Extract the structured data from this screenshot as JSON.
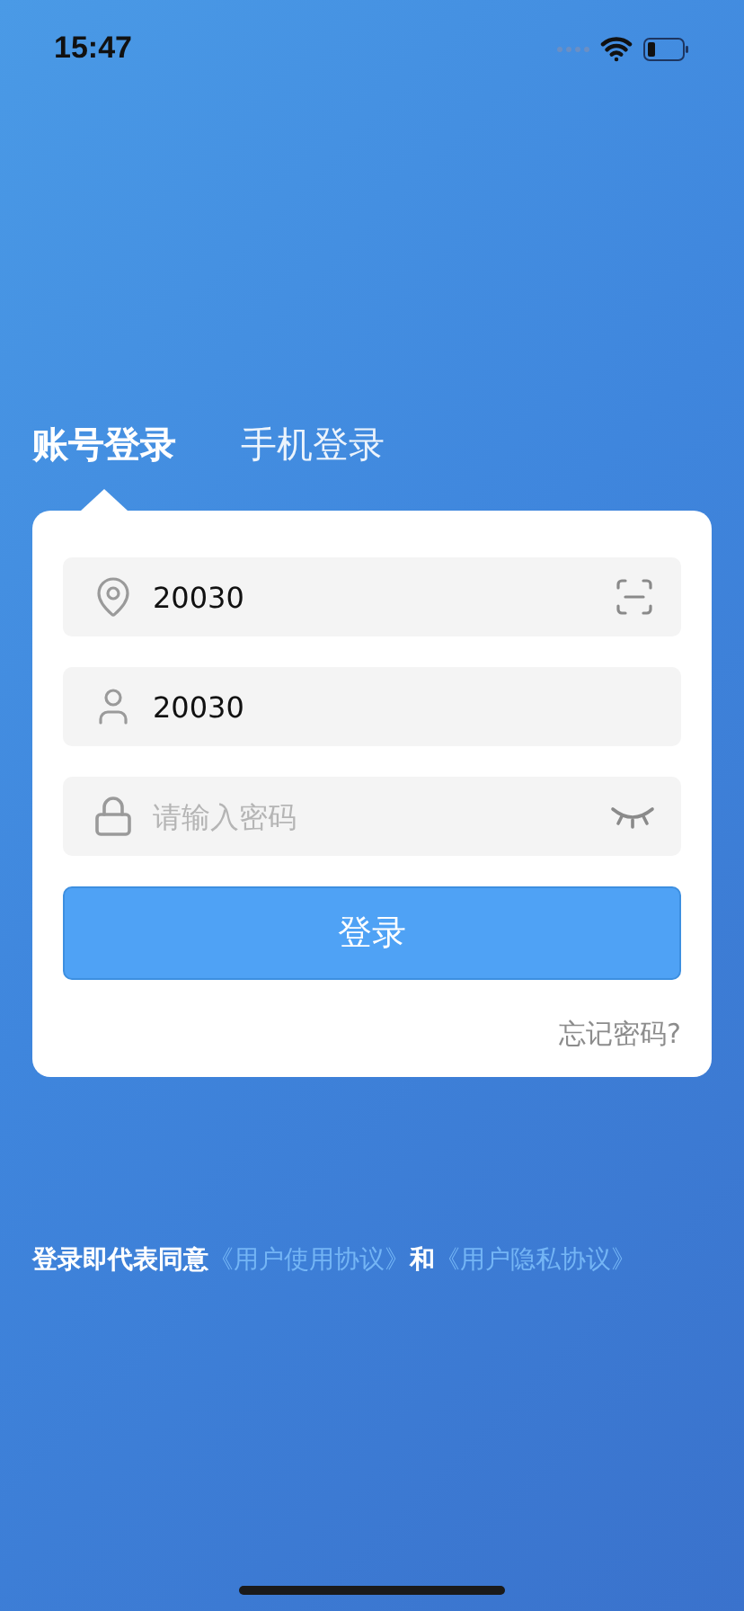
{
  "status_bar": {
    "time": "15:47"
  },
  "tabs": [
    {
      "label": "账号登录",
      "selected": true
    },
    {
      "label": "手机登录",
      "selected": false
    }
  ],
  "fields": [
    {
      "kind": "site",
      "value": "20030",
      "trailing": {
        "kind": "scan"
      }
    },
    {
      "kind": "user",
      "value": "20030"
    },
    {
      "kind": "password",
      "placeholder": "请输入密码",
      "trailing": {
        "kind": "reveal"
      }
    }
  ],
  "login_button": "登录",
  "forgot_link": "忘记密码?",
  "agreement": {
    "prefix": "登录即代表同意",
    "link_1": "《用户使用协议》",
    "joiner": "和",
    "link_2": "《用户隐私协议》"
  }
}
